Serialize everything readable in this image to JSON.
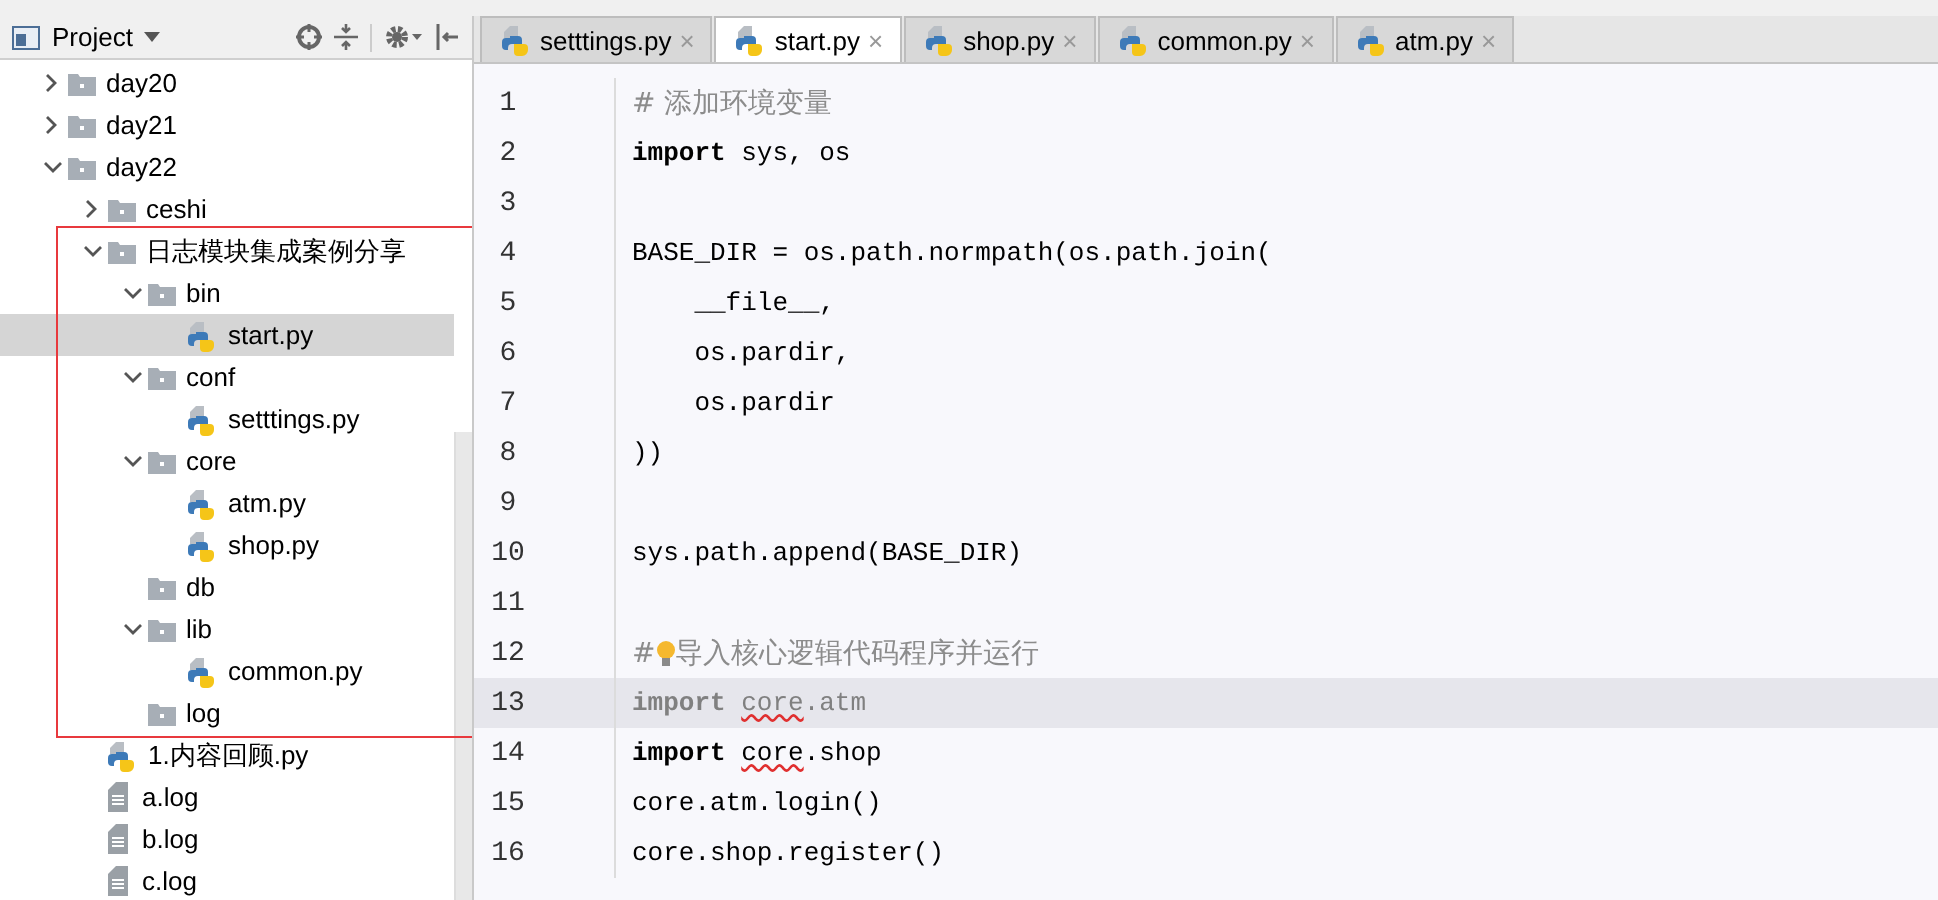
{
  "project_panel": {
    "title": "Project",
    "tree": [
      {
        "name": "day20",
        "kind": "folder",
        "expanded": false,
        "selected": false
      },
      {
        "name": "day21",
        "kind": "folder",
        "expanded": false,
        "selected": false
      },
      {
        "name": "day22",
        "kind": "folder",
        "expanded": true,
        "selected": false,
        "children": [
          {
            "name": "ceshi",
            "kind": "folder",
            "expanded": false,
            "selected": false
          },
          {
            "name": "日志模块集成案例分享",
            "kind": "folder",
            "expanded": true,
            "selected": false,
            "boxed": true,
            "children": [
              {
                "name": "bin",
                "kind": "folder",
                "expanded": true,
                "selected": false,
                "children": [
                  {
                    "name": "start.py",
                    "kind": "python",
                    "selected": true
                  }
                ]
              },
              {
                "name": "conf",
                "kind": "folder",
                "expanded": true,
                "selected": false,
                "children": [
                  {
                    "name": "setttings.py",
                    "kind": "python",
                    "selected": false
                  }
                ]
              },
              {
                "name": "core",
                "kind": "folder",
                "expanded": true,
                "selected": false,
                "children": [
                  {
                    "name": "atm.py",
                    "kind": "python",
                    "selected": false
                  },
                  {
                    "name": "shop.py",
                    "kind": "python",
                    "selected": false
                  }
                ]
              },
              {
                "name": "db",
                "kind": "folder",
                "selected": false
              },
              {
                "name": "lib",
                "kind": "folder",
                "expanded": true,
                "selected": false,
                "children": [
                  {
                    "name": "common.py",
                    "kind": "python",
                    "selected": false
                  }
                ]
              },
              {
                "name": "log",
                "kind": "folder",
                "selected": false
              }
            ]
          },
          {
            "name": "1.内容回顾.py",
            "kind": "python",
            "selected": false
          },
          {
            "name": "a.log",
            "kind": "log",
            "selected": false
          },
          {
            "name": "b.log",
            "kind": "log",
            "selected": false
          },
          {
            "name": "c.log",
            "kind": "log",
            "selected": false
          }
        ]
      }
    ]
  },
  "editor": {
    "tabs": [
      {
        "label": "setttings.py",
        "close": "×",
        "selected": false
      },
      {
        "label": "start.py",
        "close": "×",
        "selected": true
      },
      {
        "label": "shop.py",
        "close": "×",
        "selected": false
      },
      {
        "label": "common.py",
        "close": "×",
        "selected": false
      },
      {
        "label": "atm.py",
        "close": "×",
        "selected": false
      }
    ],
    "lines": [
      {
        "number": "1",
        "current": false,
        "segments": [
          {
            "text": "# 添加环境变量",
            "kind": "comment"
          }
        ]
      },
      {
        "number": "2",
        "current": false,
        "segments": [
          {
            "text": "import",
            "kind": "keyword"
          },
          {
            "text": " sys, os",
            "kind": "plain"
          }
        ]
      },
      {
        "number": "3",
        "current": false
      },
      {
        "number": "4",
        "current": false,
        "segments": [
          {
            "text": "BASE_DIR = os.path.normpath(os.path.join(",
            "kind": "plain"
          }
        ]
      },
      {
        "number": "5",
        "current": false,
        "segments": [
          {
            "text": "    __file__,",
            "kind": "plain"
          }
        ]
      },
      {
        "number": "6",
        "current": false,
        "segments": [
          {
            "text": "    os.pardir,",
            "kind": "plain"
          }
        ]
      },
      {
        "number": "7",
        "current": false,
        "segments": [
          {
            "text": "    os.pardir",
            "kind": "plain"
          }
        ]
      },
      {
        "number": "8",
        "current": false,
        "segments": [
          {
            "text": "))",
            "kind": "plain"
          }
        ]
      },
      {
        "number": "9",
        "current": false
      },
      {
        "number": "10",
        "current": false,
        "segments": [
          {
            "text": "sys.path.append(BASE_DIR)",
            "kind": "plain"
          }
        ]
      },
      {
        "number": "11",
        "current": false
      },
      {
        "number": "12",
        "current": false,
        "segments": [
          {
            "text": "#",
            "kind": "comment"
          },
          {
            "kind": "bulb"
          },
          {
            "text": "导入核心逻辑代码程序并运行",
            "kind": "comment"
          }
        ]
      },
      {
        "number": "13",
        "current": true,
        "segments": [
          {
            "text": "import ",
            "kind": "dim-keyword"
          },
          {
            "text": "core",
            "kind": "dim-error"
          },
          {
            "text": ".atm",
            "kind": "dim"
          }
        ]
      },
      {
        "number": "14",
        "current": false,
        "segments": [
          {
            "text": "import ",
            "kind": "keyword"
          },
          {
            "text": "core",
            "kind": "error"
          },
          {
            "text": ".shop",
            "kind": "plain"
          }
        ]
      },
      {
        "number": "15",
        "current": false,
        "segments": [
          {
            "text": "core.atm.login()",
            "kind": "plain"
          }
        ]
      },
      {
        "number": "16",
        "current": false,
        "segments": [
          {
            "text": "core.shop.register()",
            "kind": "plain"
          }
        ]
      }
    ]
  }
}
